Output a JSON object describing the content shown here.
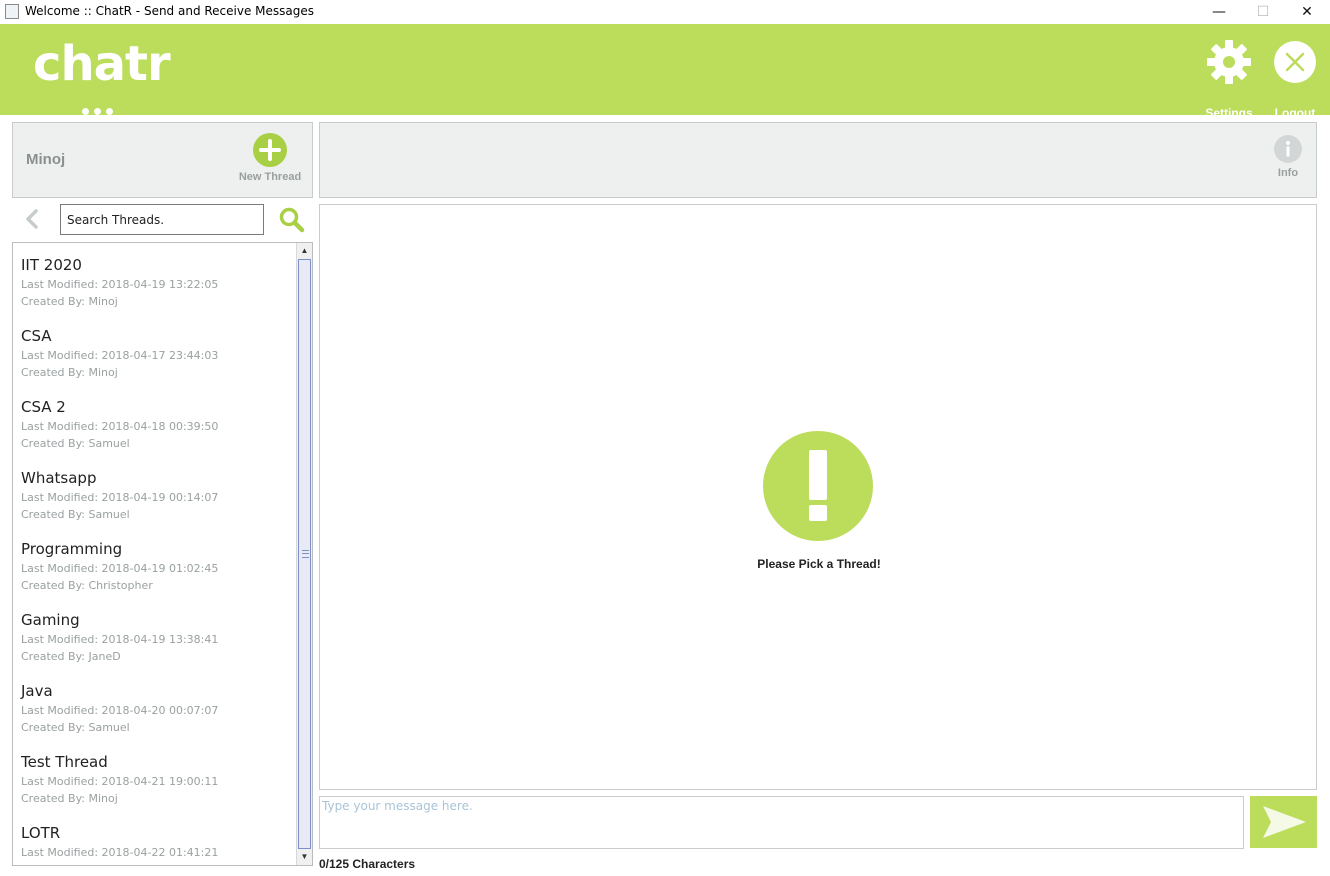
{
  "window": {
    "title": "Welcome :: ChatR - Send and Receive Messages",
    "minimize": "—",
    "maximize": "☐",
    "close": "✕"
  },
  "header": {
    "logo": "chatr",
    "settings_label": "Settings",
    "logout_label": "Logout",
    "accent_color": "#bcdc5b"
  },
  "user_panel": {
    "username": "Minoj",
    "new_thread_label": "New Thread"
  },
  "info_panel": {
    "info_label": "Info"
  },
  "search": {
    "value": "Search Threads."
  },
  "threads": [
    {
      "name": "IIT 2020",
      "modified": "Last Modified: 2018-04-19 13:22:05",
      "created_by": "Created By: Minoj"
    },
    {
      "name": "CSA",
      "modified": "Last Modified: 2018-04-17 23:44:03",
      "created_by": "Created By: Minoj"
    },
    {
      "name": "CSA 2",
      "modified": "Last Modified: 2018-04-18 00:39:50",
      "created_by": "Created By: Samuel"
    },
    {
      "name": "Whatsapp",
      "modified": "Last Modified: 2018-04-19 00:14:07",
      "created_by": "Created By: Samuel"
    },
    {
      "name": "Programming",
      "modified": "Last Modified: 2018-04-19 01:02:45",
      "created_by": "Created By: Christopher"
    },
    {
      "name": "Gaming",
      "modified": "Last Modified: 2018-04-19 13:38:41",
      "created_by": "Created By: JaneD"
    },
    {
      "name": "Java",
      "modified": "Last Modified: 2018-04-20 00:07:07",
      "created_by": "Created By: Samuel"
    },
    {
      "name": "Test Thread",
      "modified": "Last Modified: 2018-04-21 19:00:11",
      "created_by": "Created By: Minoj"
    },
    {
      "name": "LOTR",
      "modified": "Last Modified: 2018-04-22 01:41:21",
      "created_by": ""
    }
  ],
  "main": {
    "empty_message": "Please Pick a Thread!"
  },
  "composer": {
    "placeholder": "Type your message here.",
    "char_count": "0/125 Characters"
  }
}
